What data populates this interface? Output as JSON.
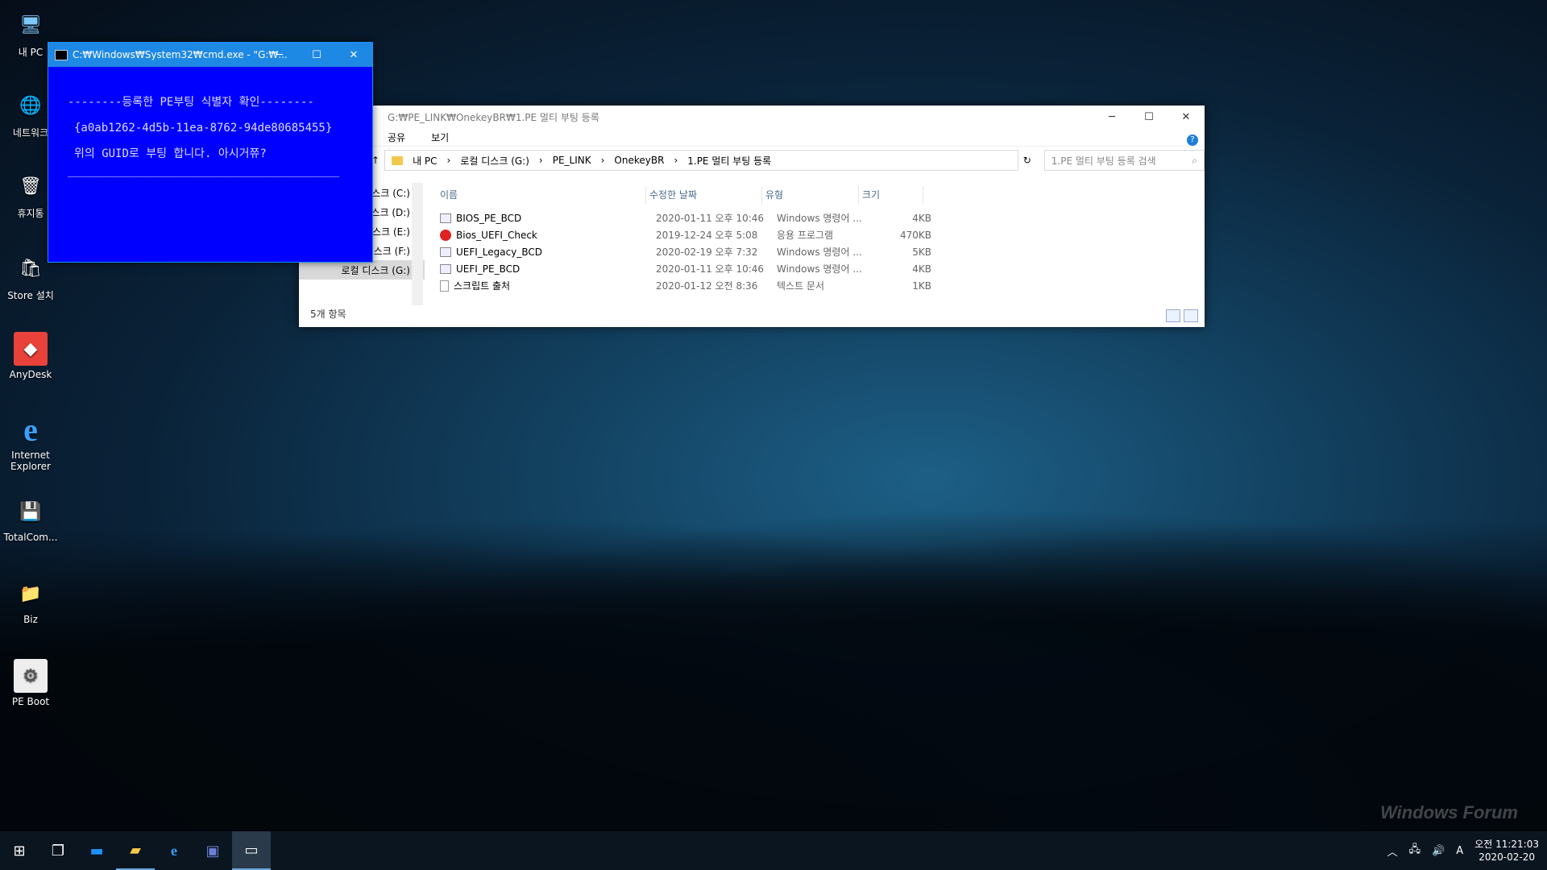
{
  "desktop": {
    "icons": [
      {
        "label": "내 PC",
        "symbol": "🖥"
      },
      {
        "label": "네트워크",
        "symbol": "🌐"
      },
      {
        "label": "휴지통",
        "symbol": "🗑"
      },
      {
        "label": "Store 설치",
        "symbol": "🛍"
      },
      {
        "label": "AnyDesk",
        "symbol": "◆"
      },
      {
        "label": "Internet Explorer",
        "symbol": "e"
      },
      {
        "label": "TotalCom...",
        "symbol": "💾"
      },
      {
        "label": "Biz",
        "symbol": "📁"
      },
      {
        "label": "PE Boot",
        "symbol": "⚙"
      }
    ]
  },
  "cmd_window": {
    "title": "C:₩Windows₩System32₩cmd.exe - \"G:₩...",
    "lines": [
      "--------등록한 PE부팅 식별자 확인--------",
      "{a0ab1262-4d5b-11ea-8762-94de80685455}",
      "위의 GUID로 부팅 합니다. 아시거쮸?",
      "________________________________________"
    ]
  },
  "explorer": {
    "title": "G:₩PE_LINK₩OnekeyBR₩1.PE 멀티 부팅 등록",
    "ribbon": [
      "공유",
      "보기"
    ],
    "breadcrumb": [
      "내 PC",
      "로컬 디스크 (G:)",
      "PE_LINK",
      "OnekeyBR",
      "1.PE 멀티 부팅 등록"
    ],
    "search_placeholder": "1.PE 멀티 부팅 등록 검색",
    "nav_items": [
      "로컬 디스크 (C:)",
      "로컬 디스크 (D:)",
      "로컬 디스크 (E:)",
      "로컬 디스크 (F:)",
      "로컬 디스크 (G:)"
    ],
    "columns": [
      "이름",
      "수정한 날짜",
      "유형",
      "크기"
    ],
    "files": [
      {
        "name": "BIOS_PE_BCD",
        "date": "2020-01-11 오후 10:46",
        "type": "Windows 명령어 ...",
        "size": "4KB",
        "icon": "cmd-file-icon"
      },
      {
        "name": "Bios_UEFI_Check",
        "date": "2019-12-24 오후 5:08",
        "type": "응용 프로그램",
        "size": "470KB",
        "icon": "app-icon"
      },
      {
        "name": "UEFI_Legacy_BCD",
        "date": "2020-02-19 오후 7:32",
        "type": "Windows 명령어 ...",
        "size": "5KB",
        "icon": "cmd-file-icon"
      },
      {
        "name": "UEFI_PE_BCD",
        "date": "2020-01-11 오후 10:46",
        "type": "Windows 명령어 ...",
        "size": "4KB",
        "icon": "cmd-file-icon"
      },
      {
        "name": "스크립트 출처",
        "date": "2020-01-12 오전 8:36",
        "type": "텍스트 문서",
        "size": "1KB",
        "icon": "text-file-icon"
      }
    ],
    "status": "5개 항목"
  },
  "taskbar": {
    "clock_time": "오전 11:21:03",
    "clock_date": "2020-02-20",
    "ime": "A"
  },
  "watermark": "Windows Forum"
}
